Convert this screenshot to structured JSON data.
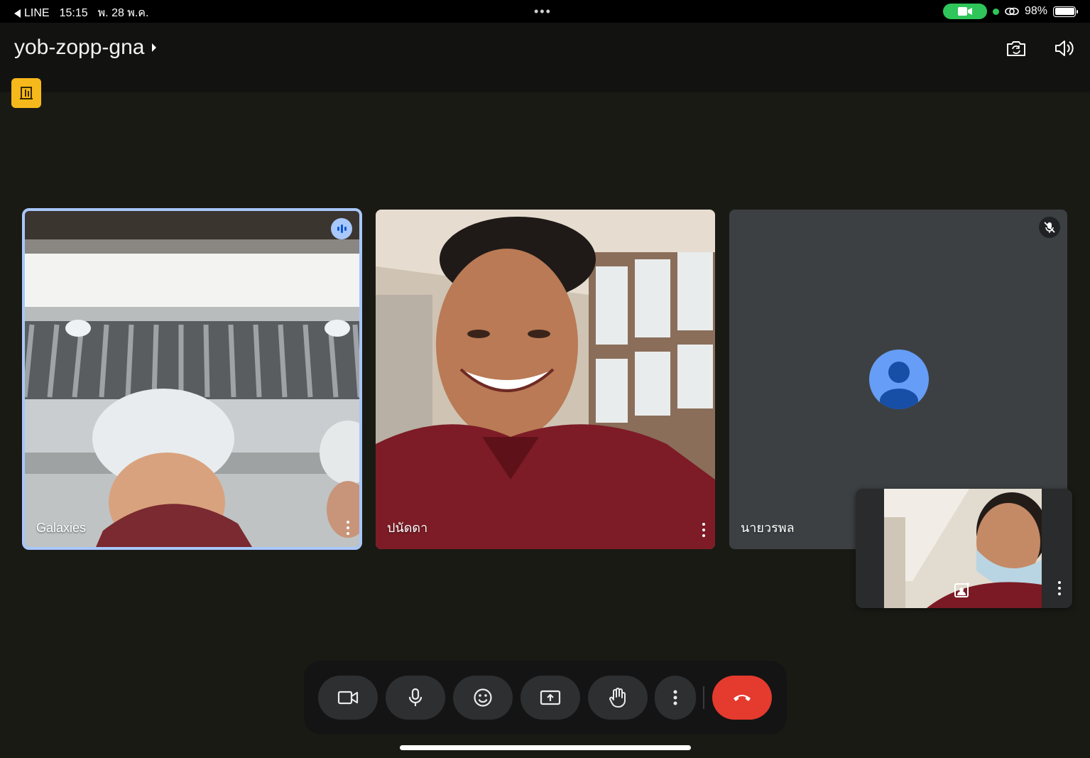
{
  "status_bar": {
    "back_app": "LINE",
    "time": "15:15",
    "date": "พ. 28 พ.ค.",
    "battery": "98%",
    "icons": [
      "back-arrow-icon",
      "camera-in-use-icon",
      "link-icon",
      "battery-icon"
    ]
  },
  "header": {
    "meeting_code": "yob-zopp-gna",
    "icons": [
      "chevron-right-icon",
      "switch-camera-icon",
      "speaker-icon",
      "recording-badge-icon"
    ]
  },
  "participants": [
    {
      "name": "Galaxies",
      "state": "speaking",
      "icons": [
        "audio-level-icon",
        "more-vert-icon"
      ]
    },
    {
      "name": "ปนัดดา",
      "state": "video",
      "icons": [
        "more-vert-icon"
      ]
    },
    {
      "name": "นายวรพล",
      "state": "muted, camera off",
      "icons": [
        "mic-off-icon",
        "avatar-icon",
        "more-vert-icon"
      ]
    }
  ],
  "self_view": {
    "icons": [
      "effects-icon",
      "more-vert-icon"
    ]
  },
  "controls": {
    "buttons": [
      {
        "id": "camera",
        "icon": "videocam-icon"
      },
      {
        "id": "mic",
        "icon": "mic-icon"
      },
      {
        "id": "reactions",
        "icon": "emoji-icon"
      },
      {
        "id": "present",
        "icon": "present-screen-icon"
      },
      {
        "id": "raise-hand",
        "icon": "hand-icon"
      },
      {
        "id": "more",
        "icon": "more-vert-icon"
      },
      {
        "id": "leave",
        "icon": "call-end-icon"
      }
    ],
    "leave_color": "#e53a2e"
  },
  "colors": {
    "background": "#1a1a15",
    "speaking_border": "#a8c7fa",
    "record_badge": "#f6b81a",
    "avatar": "#669df6"
  }
}
